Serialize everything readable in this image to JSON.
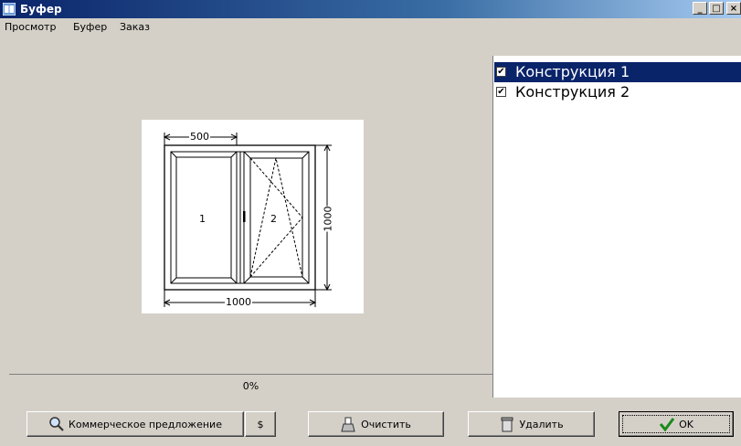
{
  "window": {
    "title": "Буфер"
  },
  "menu": [
    "Просмотр",
    "Буфер",
    "Заказ"
  ],
  "drawing": {
    "width_label": "500",
    "total_width_label": "1000",
    "height_label": "1000",
    "sash1_label": "1",
    "sash2_label": "2"
  },
  "progress": {
    "text": "0%",
    "value": 0
  },
  "list": {
    "items": [
      {
        "label": "Конструкция 1",
        "checked": true,
        "selected": true
      },
      {
        "label": "Конструкция 2",
        "checked": true,
        "selected": false
      }
    ],
    "check_mark": "✔"
  },
  "buttons": {
    "commercial": "Коммерческое предложение",
    "currency": "$",
    "clear": "Очистить",
    "delete": "Удалить",
    "ok": "OK"
  },
  "window_controls": {
    "minimize": "_",
    "maximize": "□",
    "close": "×"
  }
}
